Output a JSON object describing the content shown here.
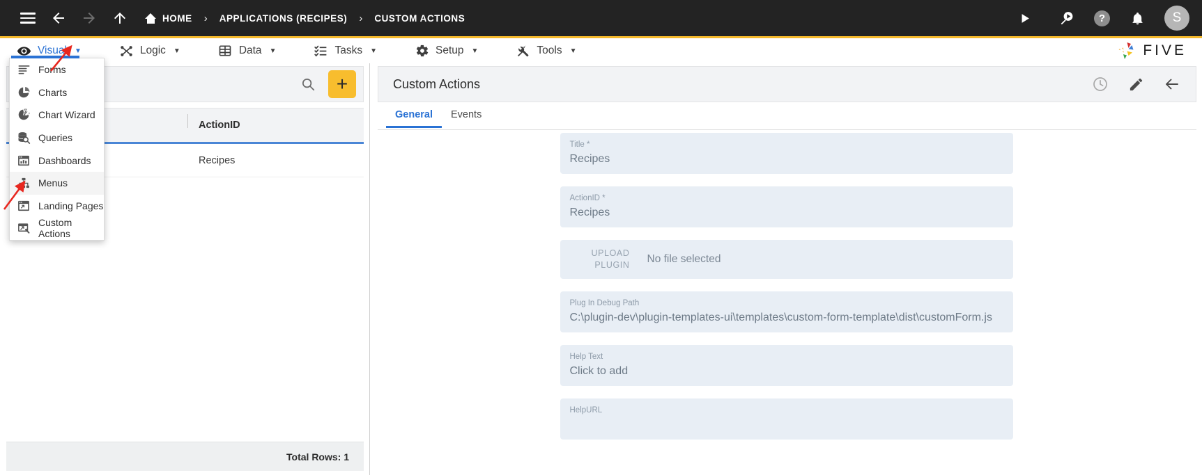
{
  "topbar": {
    "menu_icon": "hamburger-icon",
    "back_label": "back-arrow-icon",
    "forward_label": "forward-arrow-icon",
    "up_label": "up-arrow-icon",
    "breadcrumb": [
      {
        "label": "HOME",
        "icon": "home-icon"
      },
      {
        "label": "APPLICATIONS (RECIPES)",
        "icon": ""
      },
      {
        "label": "CUSTOM ACTIONS",
        "icon": ""
      }
    ],
    "separator": "›",
    "actions": [
      {
        "name": "run-icon",
        "glyph": "▶"
      },
      {
        "name": "search-debug-icon",
        "glyph": ""
      },
      {
        "name": "help-icon",
        "glyph": "?"
      },
      {
        "name": "notifications-bell-icon",
        "glyph": ""
      }
    ],
    "avatar_initial": "S"
  },
  "menubar": {
    "items": [
      {
        "label": "Visual",
        "icon": "eye-icon",
        "active": true
      },
      {
        "label": "Logic",
        "icon": "logic-nodes-icon",
        "active": false
      },
      {
        "label": "Data",
        "icon": "table-grid-icon",
        "active": false
      },
      {
        "label": "Tasks",
        "icon": "task-list-icon",
        "active": false
      },
      {
        "label": "Setup",
        "icon": "gear-icon",
        "active": false
      },
      {
        "label": "Tools",
        "icon": "tools-icon",
        "active": false
      }
    ],
    "caret": "▼",
    "brand": "FIVE",
    "accent_color": "#f5b92b",
    "active_color": "#2a72d4"
  },
  "dropdown": {
    "open_for": "Visual",
    "items": [
      {
        "label": "Forms",
        "icon": "form-lines-icon",
        "hover": false
      },
      {
        "label": "Charts",
        "icon": "pie-chart-icon",
        "hover": false
      },
      {
        "label": "Chart Wizard",
        "icon": "chart-wizard-icon",
        "hover": false
      },
      {
        "label": "Queries",
        "icon": "database-search-icon",
        "hover": false
      },
      {
        "label": "Dashboards",
        "icon": "dashboard-icon",
        "hover": false
      },
      {
        "label": "Menus",
        "icon": "menu-tree-icon",
        "hover": true
      },
      {
        "label": "Landing Pages",
        "icon": "landing-page-icon",
        "hover": false
      },
      {
        "label": "Custom Actions",
        "icon": "custom-actions-icon",
        "hover": false
      }
    ]
  },
  "left_panel": {
    "search_placeholder": "",
    "search_icon": "search-icon",
    "add_button": "+",
    "columns": [
      "ActionID"
    ],
    "rows": [
      {
        "ActionID": "Recipes"
      }
    ],
    "footer": "Total Rows: 1"
  },
  "right_panel": {
    "title": "Custom Actions",
    "actions": [
      {
        "name": "history-clock-icon",
        "enabled": false
      },
      {
        "name": "edit-pencil-icon",
        "enabled": true
      },
      {
        "name": "back-arrow-icon",
        "enabled": true
      }
    ],
    "tabs": [
      {
        "label": "General",
        "active": true
      },
      {
        "label": "Events",
        "active": false
      }
    ],
    "fields": [
      {
        "label": "Title *",
        "value": "Recipes",
        "type": "text"
      },
      {
        "label": "ActionID *",
        "value": "Recipes",
        "type": "text"
      },
      {
        "label_line1": "UPLOAD",
        "label_line2": "PLUGIN",
        "value": "No file selected",
        "type": "upload"
      },
      {
        "label": "Plug In Debug Path",
        "value": "C:\\plugin-dev\\plugin-templates-ui\\templates\\custom-form-template\\dist\\customForm.js",
        "type": "text"
      },
      {
        "label": "Help Text",
        "value": "Click to add",
        "type": "text"
      },
      {
        "label": "HelpURL",
        "value": "",
        "type": "text"
      }
    ],
    "field_bg": "#e8eef5"
  },
  "annotations": [
    {
      "name": "arrow-to-visual-caret",
      "color": "#e8271f"
    },
    {
      "name": "arrow-to-menus-item",
      "color": "#e8271f"
    }
  ]
}
